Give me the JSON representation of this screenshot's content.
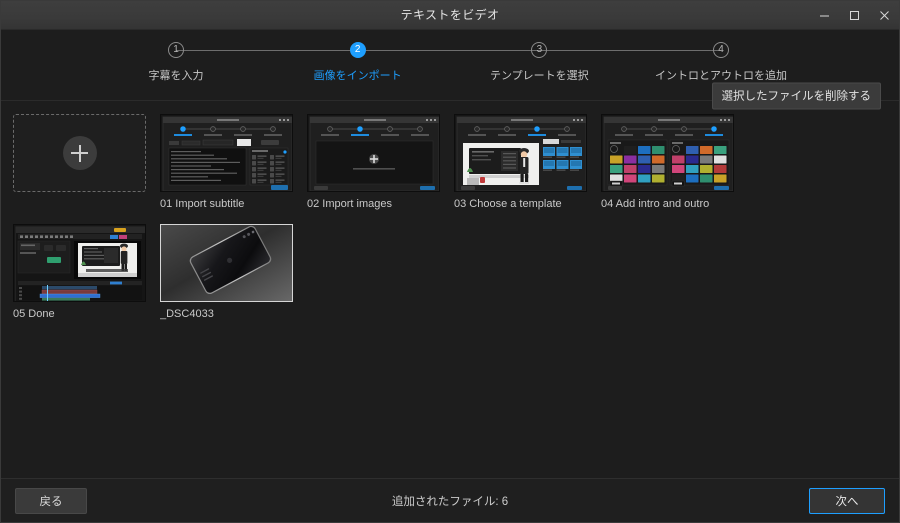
{
  "window": {
    "title": "テキストをビデオ",
    "controls": [
      {
        "name": "minimize",
        "glyph": "minimize-icon"
      },
      {
        "name": "maximize",
        "glyph": "maximize-icon"
      },
      {
        "name": "close",
        "glyph": "close-icon"
      }
    ]
  },
  "stepper": {
    "active_index": 1,
    "accent_color": "#1e9fff",
    "steps": [
      {
        "number": "1",
        "label": "字幕を入力"
      },
      {
        "number": "2",
        "label": "画像をインポート"
      },
      {
        "number": "3",
        "label": "テンプレートを選択"
      },
      {
        "number": "4",
        "label": "イントロとアウトロを追加"
      }
    ],
    "delete_button": "選択したファイルを削除する"
  },
  "main": {
    "add_tile": {
      "label": "",
      "icon": "plus-icon"
    },
    "items": [
      {
        "caption": "01 Import subtitle",
        "kind": "app-screenshot",
        "selected": false
      },
      {
        "caption": "02 Import images",
        "kind": "app-screenshot",
        "selected": false
      },
      {
        "caption": "03 Choose a template",
        "kind": "app-screenshot",
        "selected": false
      },
      {
        "caption": "04 Add intro and outro",
        "kind": "app-screenshot",
        "selected": false
      },
      {
        "caption": "05 Done",
        "kind": "app-screenshot",
        "selected": false
      },
      {
        "caption": "_DSC4033",
        "kind": "photo",
        "selected": true
      }
    ]
  },
  "footer": {
    "back_label": "戻る",
    "status": "追加されたファイル: 6",
    "next_label": "次へ"
  }
}
